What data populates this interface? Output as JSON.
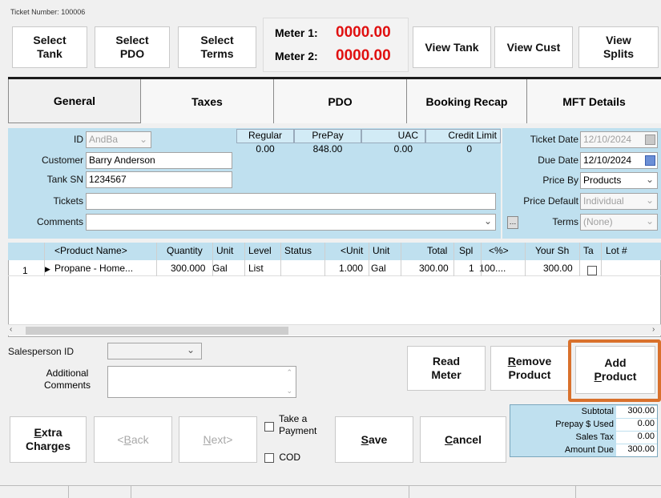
{
  "ticket": {
    "number_label": "Ticket Number:",
    "number": "100006"
  },
  "toolbar": {
    "select_tank": "Select Tank",
    "select_pdo": "Select PDO",
    "select_terms": "Select Terms",
    "meter1_label": "Meter 1:",
    "meter1_value": "0000.00",
    "meter2_label": "Meter 2:",
    "meter2_value": "0000.00",
    "view_tank": "View Tank",
    "view_cust": "View Cust",
    "view_splits": "View Splits"
  },
  "tabs": [
    "General",
    "Taxes",
    "PDO",
    "Booking Recap",
    "MFT Details"
  ],
  "general": {
    "id_label": "ID",
    "id_value": "AndBa",
    "customer_label": "Customer",
    "customer_value": "Barry Anderson",
    "tank_label": "Tank SN",
    "tank_value": "1234567",
    "tickets_label": "Tickets",
    "comments_label": "Comments",
    "summary_headers": [
      "Regular",
      "PrePay",
      "UAC",
      "Credit Limit"
    ],
    "summary_values": [
      "0.00",
      "848.00",
      "0.00",
      "0"
    ],
    "ticket_date_label": "Ticket Date",
    "ticket_date": "12/10/2024",
    "due_date_label": "Due Date",
    "due_date": "12/10/2024",
    "price_by_label": "Price By",
    "price_by": "Products",
    "price_default_label": "Price Default",
    "price_default": "Individual",
    "terms_label": "Terms",
    "terms_value": "(None)"
  },
  "grid": {
    "headers": [
      "<Product Name>",
      "Quantity",
      "Unit",
      "Level",
      "Status",
      "<Unit",
      "Unit",
      "Total",
      "Spl",
      "<%>",
      "Your Sh",
      "Ta",
      "Lot #"
    ],
    "rows": [
      {
        "num": "1",
        "product": "Propane - Home...",
        "quantity": "300.000",
        "unit": "Gal",
        "level": "List",
        "status": "",
        "unit_price": "1.000",
        "unit2": "Gal",
        "total": "300.00",
        "spl": "1",
        "pct": "100....",
        "your_sh": "300.00"
      }
    ]
  },
  "lower": {
    "salesperson_label": "Salesperson ID",
    "additional_comments_label": "Additional Comments",
    "read_meter": "Read Meter",
    "remove_product_pre": "R",
    "remove_product_rest": "emove",
    "remove_product_line2": "Product",
    "add_product_line1": "Add",
    "add_product_pre": "P",
    "add_product_rest": "roduct",
    "highlight_color": "#d9712c"
  },
  "footer": {
    "extra_pre": "E",
    "extra_rest": "xtra",
    "extra_line2": "Charges",
    "back_pre": "<",
    "back_u": "B",
    "back_rest": "ack",
    "next_u": "N",
    "next_rest": "ext>",
    "take_payment": "Take a Payment",
    "cod": "COD",
    "save_u": "S",
    "save_rest": "ave",
    "cancel_u": "C",
    "cancel_rest": "ancel"
  },
  "summary": {
    "subtotal_label": "Subtotal",
    "subtotal": "300.00",
    "prepay_label": "Prepay $ Used",
    "prepay": "0.00",
    "tax_label": "Sales Tax",
    "tax": "0.00",
    "due_label": "Amount Due",
    "due": "300.00"
  }
}
